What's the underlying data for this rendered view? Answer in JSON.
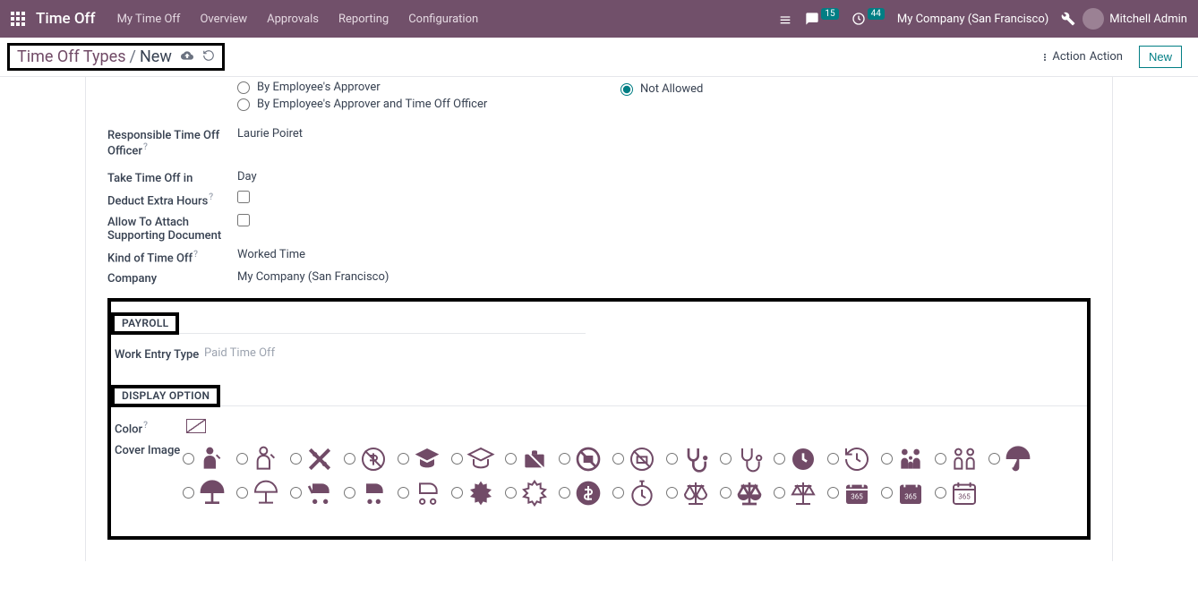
{
  "topnav": {
    "brand": "Time Off",
    "items": [
      "My Time Off",
      "Overview",
      "Approvals",
      "Reporting",
      "Configuration"
    ],
    "chat_badge": "15",
    "clock_badge": "44",
    "company": "My Company (San Francisco)",
    "user": "Mitchell Admin"
  },
  "subhead": {
    "breadcrumb_root": "Time Off Types",
    "breadcrumb_sep": "/",
    "breadcrumb_current": "New",
    "action_label": "Action",
    "new_label": "New"
  },
  "form": {
    "approver_option1": "By Employee's Approver",
    "approver_option2": "By Employee's Approver and Time Off Officer",
    "allocation_notallowed": "Not Allowed",
    "responsible_label": "Responsible Time Off Officer",
    "responsible_value": "Laurie Poiret",
    "takein_label": "Take Time Off in",
    "takein_value": "Day",
    "deduct_label": "Deduct Extra Hours",
    "attach_label": "Allow To Attach Supporting Document",
    "kind_label": "Kind of Time Off",
    "kind_value": "Worked Time",
    "company_label": "Company",
    "company_value": "My Company (San Francisco)"
  },
  "payroll": {
    "section_title": "PAYROLL",
    "wet_label": "Work Entry Type",
    "wet_value": "Paid Time Off"
  },
  "display": {
    "section_title": "DISPLAY OPTION",
    "color_label": "Color",
    "cover_label": "Cover Image"
  }
}
